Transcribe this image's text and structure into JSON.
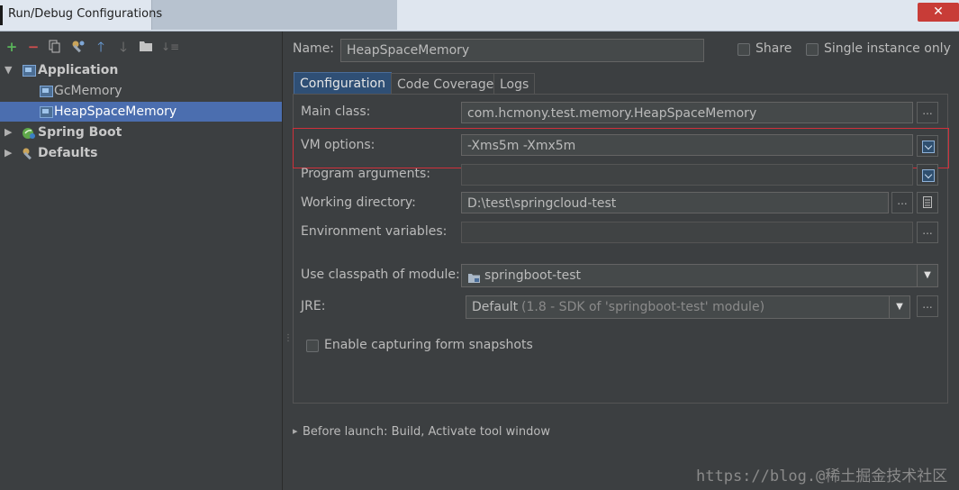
{
  "window": {
    "title": "Run/Debug Configurations",
    "close_symbol": "✕"
  },
  "toolbar": {
    "icons": [
      "add-icon",
      "remove-icon",
      "copy-icon",
      "wrench-icon",
      "move-up-icon",
      "move-down-icon",
      "folder-icon",
      "sort-icon"
    ]
  },
  "tree": {
    "application": "Application",
    "gcmemory": "GcMemory",
    "heapspacememory": "HeapSpaceMemory",
    "springboot": "Spring Boot",
    "defaults": "Defaults"
  },
  "header": {
    "name_label": "Name:",
    "name_value": "HeapSpaceMemory",
    "share_label": "Share",
    "single_instance_label": "Single instance only"
  },
  "tabs": [
    "Configuration",
    "Code Coverage",
    "Logs"
  ],
  "form": {
    "main_class_label": "Main class:",
    "main_class_value": "com.hcmony.test.memory.HeapSpaceMemory",
    "vm_options_label": "VM options:",
    "vm_options_value": "-Xms5m -Xmx5m",
    "program_args_label": "Program arguments:",
    "working_dir_label": "Working directory:",
    "working_dir_value": "D:\\test\\springcloud-test",
    "env_vars_label": "Environment variables:",
    "classpath_label": "Use classpath of module:",
    "classpath_value": "springboot-test",
    "jre_label": "JRE:",
    "jre_value": "Default",
    "jre_detail": "(1.8 - SDK of 'springboot-test' module)",
    "snapshots_label": "Enable capturing form snapshots",
    "ellipsis": "...",
    "dropdown_arrow": "▼"
  },
  "before_launch": {
    "label": "Before launch: Build, Activate tool window",
    "arrow": "▸"
  },
  "watermark": "https://blog.@稀土掘金技术社区",
  "colors": {
    "selection": "#4b6eaf",
    "highlight_border": "#d0303b",
    "add_green": "#5ab55a",
    "remove_red": "#d34f4f"
  }
}
